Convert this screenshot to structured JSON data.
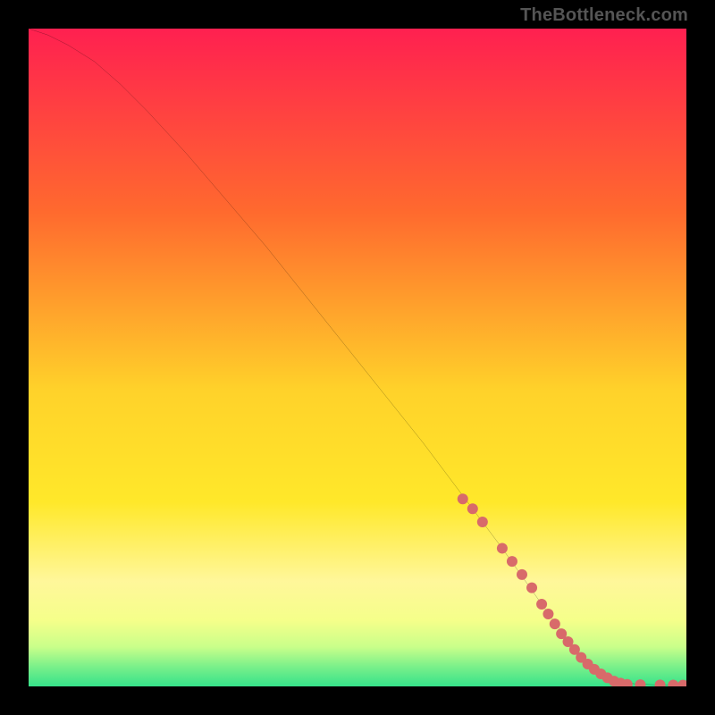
{
  "watermark": "TheBottleneck.com",
  "chart_data": {
    "type": "line",
    "title": "",
    "xlabel": "",
    "ylabel": "",
    "xlim": [
      0,
      100
    ],
    "ylim": [
      0,
      100
    ],
    "axes_visible": false,
    "background_gradient": {
      "top": "#ff2050",
      "mid1": "#ff8a2a",
      "mid2": "#ffe62a",
      "band1": "#fff79a",
      "band2": "#f5ff8a",
      "band3": "#c9ff8a",
      "bottom": "#36e28a"
    },
    "series": [
      {
        "name": "curve",
        "type": "line",
        "color": "#000000",
        "stroke_width": 1.4,
        "x": [
          0,
          3,
          6,
          10,
          14,
          18,
          24,
          30,
          36,
          42,
          48,
          54,
          60,
          66,
          72,
          78,
          82,
          85,
          88,
          92,
          96,
          100
        ],
        "y": [
          100,
          99,
          97.5,
          95,
          91.5,
          87.5,
          81,
          74,
          67,
          59.5,
          52,
          44.5,
          37,
          29,
          21,
          12.5,
          7,
          3.5,
          1.2,
          0.4,
          0.2,
          0.2
        ]
      },
      {
        "name": "highlight-points",
        "type": "scatter",
        "color": "#d86a6a",
        "radius": 6,
        "x": [
          66,
          67.5,
          69,
          72,
          73.5,
          75,
          76.5,
          78,
          79,
          80,
          81,
          82,
          83,
          84,
          85,
          86,
          87,
          88,
          89,
          90,
          91,
          93,
          96,
          98,
          99.5
        ],
        "y": [
          28.5,
          27,
          25,
          21,
          19,
          17,
          15,
          12.5,
          11,
          9.5,
          8,
          6.8,
          5.6,
          4.4,
          3.4,
          2.6,
          1.9,
          1.3,
          0.8,
          0.5,
          0.3,
          0.25,
          0.22,
          0.2,
          0.2
        ]
      }
    ]
  }
}
